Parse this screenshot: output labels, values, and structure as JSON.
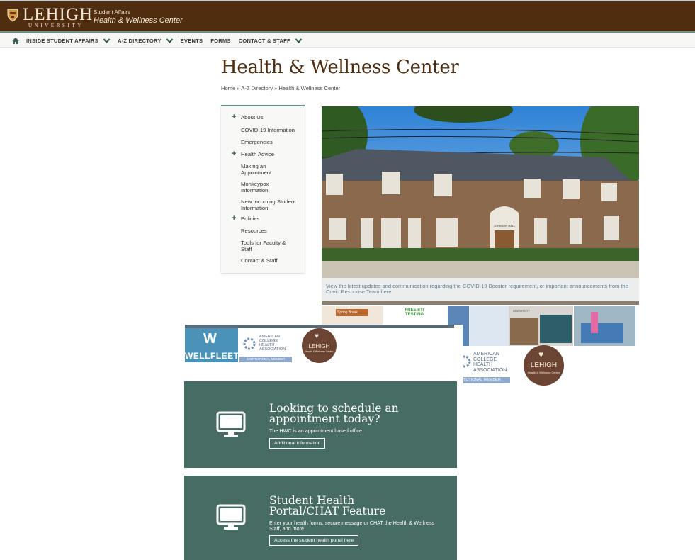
{
  "header": {
    "logo_text": "LEHIGH",
    "logo_subtext": "UNIVERSITY",
    "unit_department": "Student Affairs",
    "unit_name": "Health & Wellness Center"
  },
  "nav": {
    "items": [
      {
        "label": "INSIDE STUDENT AFFAIRS",
        "dropdown": true
      },
      {
        "label": "A-Z DIRECTORY",
        "dropdown": true
      },
      {
        "label": "EVENTS",
        "dropdown": false
      },
      {
        "label": "FORMS",
        "dropdown": false
      },
      {
        "label": "CONTACT & STAFF",
        "dropdown": true
      }
    ]
  },
  "page": {
    "title": "Health & Wellness Center",
    "breadcrumb": "Home » A-Z Directory » Health & Wellness Center"
  },
  "sidebar": {
    "items": [
      {
        "label": "About Us",
        "expandable": true
      },
      {
        "label": "COVID-19 Information",
        "expandable": false
      },
      {
        "label": "Emergencies",
        "expandable": false
      },
      {
        "label": "Health Advice",
        "expandable": true
      },
      {
        "label": "Making an Appointment",
        "expandable": false
      },
      {
        "label": "Monkeypox Information",
        "expandable": false
      },
      {
        "label": "New Incoming Student Information",
        "expandable": false
      },
      {
        "label": "Policies",
        "expandable": true
      },
      {
        "label": "Resources",
        "expandable": false
      },
      {
        "label": "Tools for Faculty & Staff",
        "expandable": false
      },
      {
        "label": "Contact & Staff",
        "expandable": false
      }
    ]
  },
  "hero": {
    "building_sign": "JOHNSON HALL",
    "caption": "View the latest updates and communication regarding the COVID-19 Booster requirement, or important announcements from the Covid Response Team here"
  },
  "thumbnails": {
    "spring_break": "Spring Break",
    "sti_testing": "FREE STI TESTING",
    "uni_label": "UNIVERSITY"
  },
  "partners": {
    "wellfleet": "WELLFLEET",
    "acha_line1": "AMERICAN",
    "acha_line2": "COLLEGE",
    "acha_line3": "HEALTH",
    "acha_line4": "ASSOCIATION",
    "acha_member": "INSTITUTIONAL MEMBER",
    "acha2_member": "TUTIONAL MEMBER",
    "hwc_logo_text": "LEHIGH",
    "hwc_logo_sub": "Health & Wellness Center"
  },
  "panels": [
    {
      "title": "Looking to schedule an appointment today?",
      "text": "The HWC is an appointment based office.",
      "button": "Additional information"
    },
    {
      "title": "Student Health Portal/CHAT Feature",
      "text": "Enter your health forms, secure message or CHAT the Health & Wellness Staff, and more",
      "button": "Access the student health portal here"
    }
  ],
  "colors": {
    "brand_brown": "#502d0e",
    "accent_green": "#67918a",
    "panel_green": "#476c64"
  }
}
